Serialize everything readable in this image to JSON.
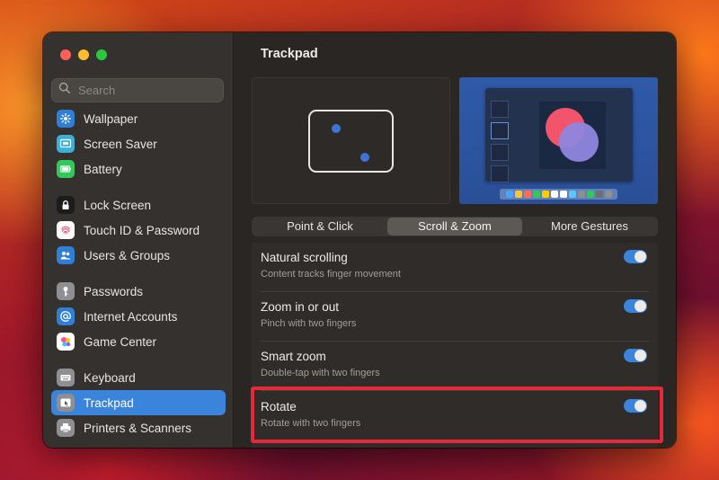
{
  "window": {
    "title": "Trackpad"
  },
  "sidebar": {
    "search_placeholder": "Search",
    "items": [
      {
        "label": "Wallpaper",
        "icon": "wallpaper-icon",
        "color": "#2f7fd8"
      },
      {
        "label": "Screen Saver",
        "icon": "screen-saver-icon",
        "color": "#3bb0d8"
      },
      {
        "label": "Battery",
        "icon": "battery-icon",
        "color": "#34c759"
      },
      {
        "label": "Lock Screen",
        "icon": "lock-icon",
        "color": "#1c1c1e"
      },
      {
        "label": "Touch ID & Password",
        "icon": "fingerprint-icon",
        "color": "#ffffff"
      },
      {
        "label": "Users & Groups",
        "icon": "users-icon",
        "color": "#2f7fd8"
      },
      {
        "label": "Passwords",
        "icon": "key-icon",
        "color": "#8e8e93"
      },
      {
        "label": "Internet Accounts",
        "icon": "at-sign-icon",
        "color": "#2f7fd8"
      },
      {
        "label": "Game Center",
        "icon": "game-center-icon",
        "color": "#ffffff"
      },
      {
        "label": "Keyboard",
        "icon": "keyboard-icon",
        "color": "#8e8e93"
      },
      {
        "label": "Trackpad",
        "icon": "trackpad-icon",
        "color": "#8e8e93"
      },
      {
        "label": "Printers & Scanners",
        "icon": "printer-icon",
        "color": "#8e8e93"
      }
    ],
    "selected": "Trackpad"
  },
  "tabs": [
    {
      "label": "Point & Click"
    },
    {
      "label": "Scroll & Zoom"
    },
    {
      "label": "More Gestures"
    }
  ],
  "selected_tab": "Scroll & Zoom",
  "settings": [
    {
      "label": "Natural scrolling",
      "description": "Content tracks finger movement",
      "enabled": true
    },
    {
      "label": "Zoom in or out",
      "description": "Pinch with two fingers",
      "enabled": true
    },
    {
      "label": "Smart zoom",
      "description": "Double-tap with two fingers",
      "enabled": true
    },
    {
      "label": "Rotate",
      "description": "Rotate with two fingers",
      "enabled": true
    }
  ],
  "colors": {
    "accent": "#3a84dc",
    "highlight": "#e5283a",
    "dock": [
      "#4aa3ff",
      "#f5c542",
      "#ff6b5a",
      "#34c759",
      "#ffcc00",
      "#ffffff",
      "#ffffff",
      "#5ac8fa",
      "#8e8e93",
      "#34c759",
      "#6e6e73",
      "#8e8e93"
    ]
  }
}
